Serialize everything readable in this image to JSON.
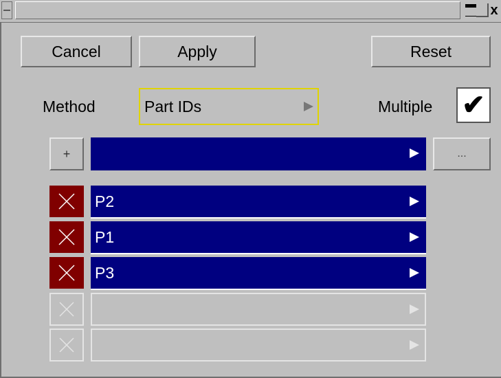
{
  "toolbar": {
    "cancel_label": "Cancel",
    "apply_label": "Apply",
    "reset_label": "Reset"
  },
  "method": {
    "label": "Method",
    "value": "Part IDs"
  },
  "multiple": {
    "label": "Multiple",
    "checked": true,
    "check_glyph": "✔"
  },
  "add_row": {
    "add_label": "+",
    "browse_label": "..."
  },
  "items": [
    {
      "label": "P2"
    },
    {
      "label": "P1"
    },
    {
      "label": "P3"
    },
    {
      "label": ""
    },
    {
      "label": ""
    }
  ],
  "titlebar": {
    "close_glyph": "x"
  },
  "colors": {
    "selected_row": "#000080",
    "delete_active": "#800000",
    "panel": "#bfbfbf",
    "focus": "#e0d400"
  }
}
